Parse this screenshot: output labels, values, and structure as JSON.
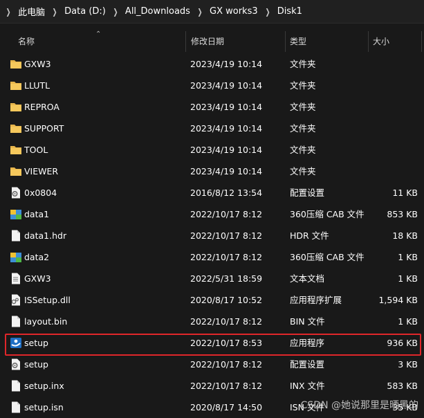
{
  "breadcrumb": {
    "items": [
      "此电脑",
      "Data (D:)",
      "All_Downloads",
      "GX works3",
      "Disk1"
    ]
  },
  "columns": {
    "name": "名称",
    "date": "修改日期",
    "type": "类型",
    "size": "大小"
  },
  "files": [
    {
      "name": "GXW3",
      "date": "2023/4/19 10:14",
      "type": "文件夹",
      "size": "",
      "icon": "folder-icon"
    },
    {
      "name": "LLUTL",
      "date": "2023/4/19 10:14",
      "type": "文件夹",
      "size": "",
      "icon": "folder-icon"
    },
    {
      "name": "REPROA",
      "date": "2023/4/19 10:14",
      "type": "文件夹",
      "size": "",
      "icon": "folder-icon"
    },
    {
      "name": "SUPPORT",
      "date": "2023/4/19 10:14",
      "type": "文件夹",
      "size": "",
      "icon": "folder-icon"
    },
    {
      "name": "TOOL",
      "date": "2023/4/19 10:14",
      "type": "文件夹",
      "size": "",
      "icon": "folder-icon"
    },
    {
      "name": "VIEWER",
      "date": "2023/4/19 10:14",
      "type": "文件夹",
      "size": "",
      "icon": "folder-icon"
    },
    {
      "name": "0x0804",
      "date": "2016/8/12 13:54",
      "type": "配置设置",
      "size": "11 KB",
      "icon": "settings-file-icon"
    },
    {
      "name": "data1",
      "date": "2022/10/17 8:12",
      "type": "360压缩 CAB 文件",
      "size": "853 KB",
      "icon": "archive-file-icon"
    },
    {
      "name": "data1.hdr",
      "date": "2022/10/17 8:12",
      "type": "HDR 文件",
      "size": "18 KB",
      "icon": "blank-file-icon"
    },
    {
      "name": "data2",
      "date": "2022/10/17 8:12",
      "type": "360压缩 CAB 文件",
      "size": "1 KB",
      "icon": "archive-file-icon"
    },
    {
      "name": "GXW3",
      "date": "2022/5/31 18:59",
      "type": "文本文档",
      "size": "1 KB",
      "icon": "text-file-icon"
    },
    {
      "name": "ISSetup.dll",
      "date": "2020/8/17 10:52",
      "type": "应用程序扩展",
      "size": "1,594 KB",
      "icon": "dll-file-icon"
    },
    {
      "name": "layout.bin",
      "date": "2022/10/17 8:12",
      "type": "BIN 文件",
      "size": "1 KB",
      "icon": "blank-file-icon"
    },
    {
      "name": "setup",
      "date": "2022/10/17 8:53",
      "type": "应用程序",
      "size": "936 KB",
      "icon": "setup-app-icon",
      "highlighted": true
    },
    {
      "name": "setup",
      "date": "2022/10/17 8:12",
      "type": "配置设置",
      "size": "3 KB",
      "icon": "settings-file-icon"
    },
    {
      "name": "setup.inx",
      "date": "2022/10/17 8:12",
      "type": "INX 文件",
      "size": "583 KB",
      "icon": "blank-file-icon"
    },
    {
      "name": "setup.isn",
      "date": "2020/8/17 14:50",
      "type": "ISN 文件",
      "size": "35 KB",
      "icon": "blank-file-icon"
    }
  ],
  "colors": {
    "background": "#191919",
    "folder": "#e8b64c",
    "highlight_border": "#e0262a"
  },
  "watermark": "CSDN @她说那里是晒黑的"
}
